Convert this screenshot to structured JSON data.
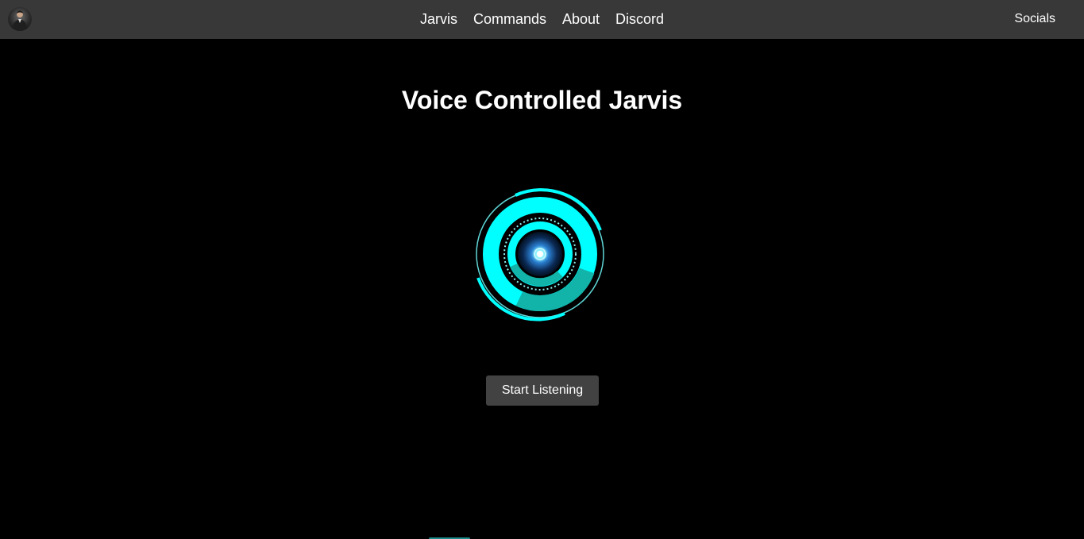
{
  "nav": {
    "avatar_icon": "user-avatar-icon",
    "links": [
      {
        "label": "Jarvis"
      },
      {
        "label": "Commands"
      },
      {
        "label": "About"
      },
      {
        "label": "Discord"
      }
    ],
    "socials_label": "Socials"
  },
  "main": {
    "title": "Voice Controlled Jarvis",
    "reactor_icon": "arc-reactor-icon",
    "start_button_label": "Start Listening"
  },
  "colors": {
    "navbar_bg": "#383838",
    "page_bg": "#000000",
    "accent_cyan": "#00ffff",
    "accent_teal": "#12b3a8",
    "button_bg": "#424242"
  }
}
